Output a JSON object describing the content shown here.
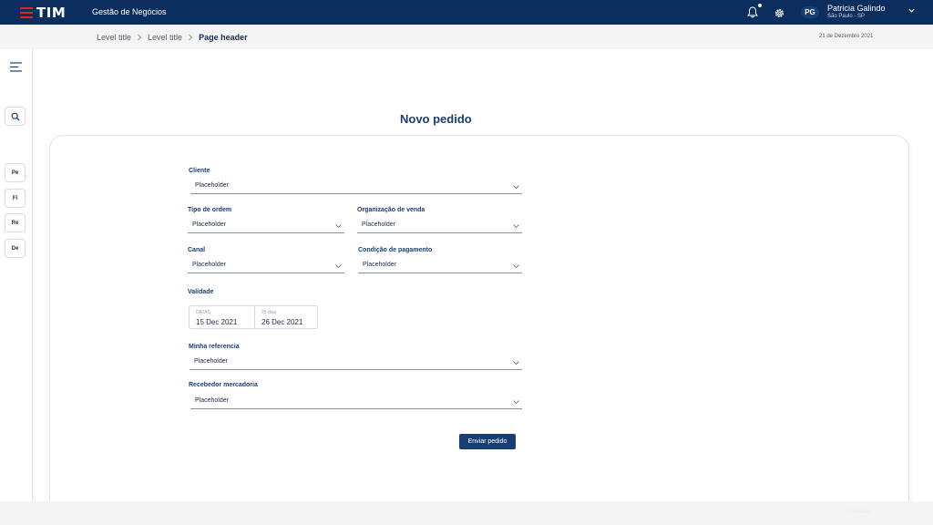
{
  "header": {
    "logo_text": "TIM",
    "app_title": "Gestão de Negócios",
    "user": {
      "initials": "PG",
      "name": "Patricia Galindo",
      "location": "São Paulo - SP"
    },
    "brand_color": "#0b2e5f",
    "logo_accent": "#e2231a"
  },
  "breadcrumb": {
    "items": [
      "Level title",
      "Level title"
    ],
    "current": "Page header",
    "date": "21 de Dezembro 2021"
  },
  "sidebar": {
    "tabs": [
      "Pe",
      "Fi",
      "Re",
      "De"
    ]
  },
  "form": {
    "title": "Novo pedido",
    "cliente": {
      "label": "Cliente",
      "placeholder": "Placeholder"
    },
    "tipo_ordem": {
      "label": "Tipo de ordem",
      "placeholder": "Placeholder"
    },
    "org_venda": {
      "label": "Organização de venda",
      "placeholder": "Placeholder"
    },
    "canal": {
      "label": "Canal",
      "placeholder": "Placeholder"
    },
    "cond_pagamento": {
      "label": "Condição de pagamento",
      "placeholder": "Placeholder"
    },
    "validade": {
      "label": "Validade",
      "start_caption": "DATAS",
      "start_value": "15 Dec 2021",
      "end_caption": "25 dias",
      "end_value": "26 Dec 2021"
    },
    "minha_referencia": {
      "label": "Minha referencia",
      "placeholder": "Placeholder"
    },
    "recebedor": {
      "label": "Recebedor mercadoria",
      "placeholder": "Placeholder"
    },
    "submit_label": "Enviar pedido"
  },
  "footer": {
    "text": "Conexão"
  }
}
